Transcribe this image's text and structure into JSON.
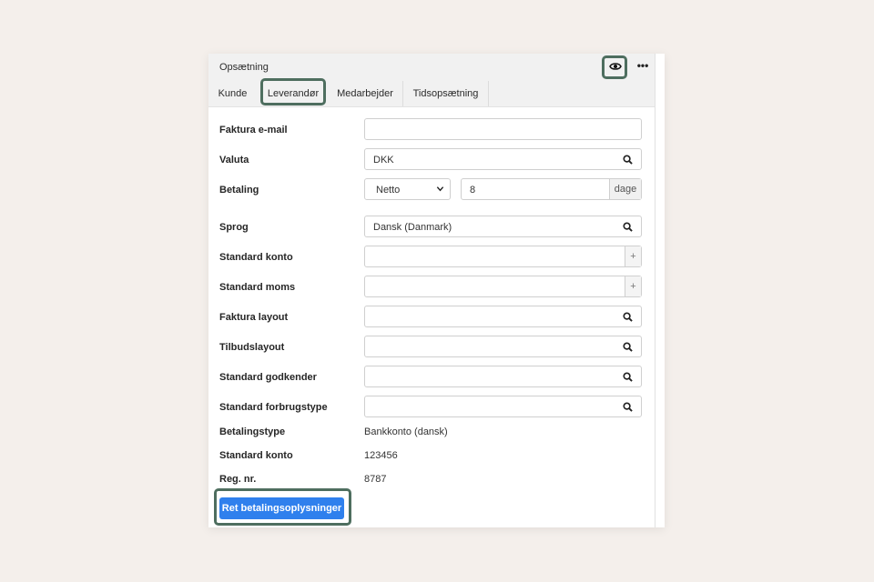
{
  "panel": {
    "title": "Opsætning",
    "icons": {
      "eye": "eye-icon",
      "more": "more-horizontal-icon",
      "search": "search-icon"
    }
  },
  "tabs": [
    {
      "label": "Kunde"
    },
    {
      "label": "Leverandør",
      "active": true
    },
    {
      "label": "Medarbejder"
    },
    {
      "label": "Tidsopsætning"
    }
  ],
  "form": {
    "faktura_email": {
      "label": "Faktura e-mail",
      "value": ""
    },
    "valuta": {
      "label": "Valuta",
      "value": "DKK"
    },
    "betaling": {
      "label": "Betaling",
      "select_value": "Netto",
      "days": "8",
      "days_unit": "dage"
    },
    "sprog": {
      "label": "Sprog",
      "value": "Dansk (Danmark)"
    },
    "standard_konto": {
      "label": "Standard konto",
      "value": "",
      "addon": "+"
    },
    "standard_moms": {
      "label": "Standard moms",
      "value": "",
      "addon": "+"
    },
    "faktura_layout": {
      "label": "Faktura layout",
      "value": ""
    },
    "tilbudslayout": {
      "label": "Tilbudslayout",
      "value": ""
    },
    "standard_godkender": {
      "label": "Standard godkender",
      "value": ""
    },
    "standard_forbrugstype": {
      "label": "Standard forbrugstype",
      "value": ""
    }
  },
  "payment_info": {
    "betalingstype": {
      "label": "Betalingstype",
      "value": "Bankkonto (dansk)"
    },
    "standard_konto": {
      "label": "Standard konto",
      "value": "123456"
    },
    "reg_nr": {
      "label": "Reg. nr.",
      "value": "8787"
    }
  },
  "button": {
    "label": "Ret betalingsoplysninger"
  },
  "colors": {
    "accent": "#2f80ed",
    "highlight": "#4e6e5f",
    "background": "#f4efeb"
  }
}
